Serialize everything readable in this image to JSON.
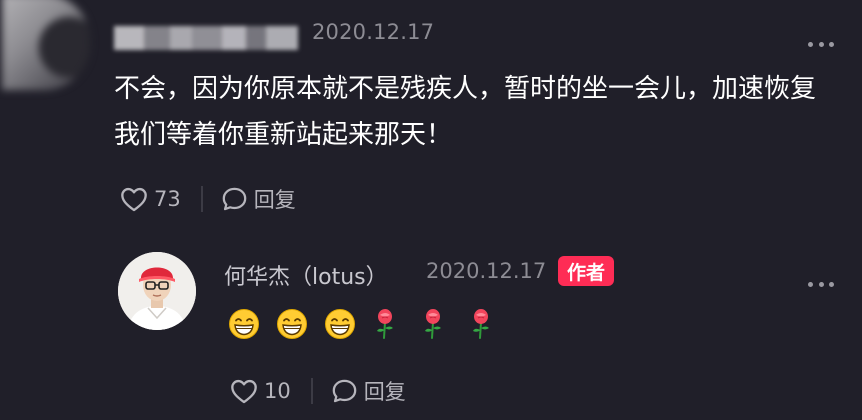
{
  "comment": {
    "author_name": "",
    "date": "2020.12.17",
    "text": "不会，因为你原本就不是残疾人，暂时的坐一会儿，加速恢复我们等着你重新站起来那天！",
    "likes": "73",
    "reply_label": "回复",
    "icons": [
      "heart-icon",
      "comment-bubble-icon",
      "more-icon"
    ]
  },
  "reply": {
    "author_name": "何华杰（lotus）",
    "date": "2020.12.17",
    "badge": "作者",
    "content_emojis": [
      "grinning-face",
      "grinning-face",
      "grinning-face",
      "rose",
      "rose",
      "rose"
    ],
    "likes": "10",
    "reply_label": "回复"
  },
  "colors": {
    "background": "#201f29",
    "accent_badge": "#fe2c55",
    "text_primary": "#ffffff",
    "text_secondary": "#8d8c94"
  }
}
